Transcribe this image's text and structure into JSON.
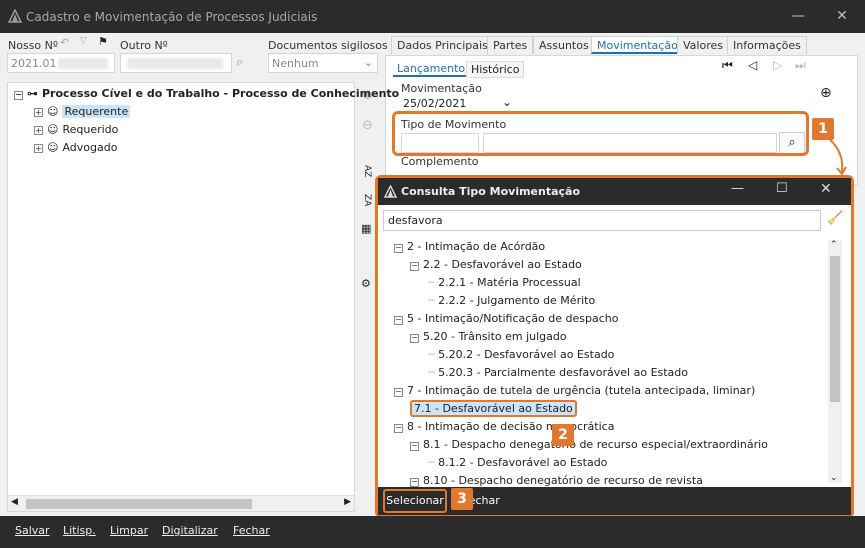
{
  "window": {
    "title": "Cadastro e Movimentação de Processos Judiciais"
  },
  "header": {
    "nosso_no_label": "Nosso Nº",
    "nosso_no_value": "2021.01",
    "outro_no_label": "Outro Nº",
    "docs_label": "Documentos sigilosos",
    "docs_value": "Nenhum"
  },
  "tabs": [
    "Dados Principais",
    "Partes",
    "Assuntos",
    "Movimentação",
    "Valores",
    "Informações"
  ],
  "subtabs": [
    "Lançamento",
    "Histórico"
  ],
  "tree": {
    "root": "Processo Cível e do Trabalho - Processo de Conhecimento",
    "items": [
      "Requerente",
      "Requerido",
      "Advogado"
    ]
  },
  "movimentacao": {
    "label": "Movimentação",
    "date": "25/02/2021",
    "tipo_label": "Tipo de Movimento",
    "complemento_label": "Complemento"
  },
  "dialog": {
    "title": "Consulta Tipo Movimentação",
    "search_value": "desfavora",
    "rows": [
      "2 - Intimação de Acórdão",
      "2.2 - Desfavorável ao Estado",
      "2.2.1 - Matéria Processual",
      "2.2.2 - Julgamento de Mérito",
      "5 - Intimação/Notificação de despacho",
      "5.20 - Trânsito em julgado",
      "5.20.2 - Desfavorável ao Estado",
      "5.20.3 - Parcialmente desfavorável ao Estado",
      "7 - Intimação de tutela de urgência (tutela antecipada, liminar)",
      "7.1 - Desfavorável ao Estado",
      "8 - Intimação de decisão monocrática",
      "8.1 - Despacho denegatório de recurso especial/extraordinário",
      "8.1.2 - Desfavorável ao Estado",
      "8.10 - Despacho denegatório de recurso de revista"
    ],
    "select_label": "Selecionar",
    "close_label": "Fechar"
  },
  "badges": [
    "1",
    "2",
    "3"
  ],
  "bottom": [
    "Salvar",
    "Litisp.",
    "Limpar",
    "Digitalizar",
    "Fechar"
  ],
  "colors": {
    "accent": "#e0782e",
    "tab_active": "#1f6fb7",
    "dark": "#2b2b2b",
    "selected_bg": "#cce4f7"
  }
}
